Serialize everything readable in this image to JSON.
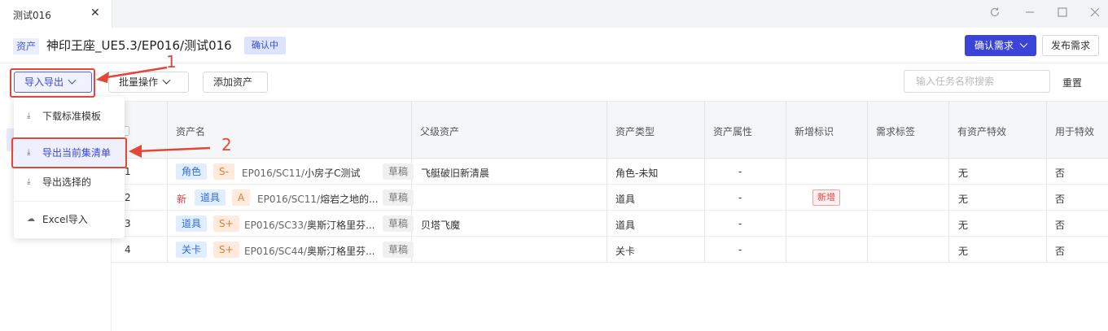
{
  "window": {
    "tab_title": "测试016",
    "tab_close": "✕"
  },
  "header": {
    "asset_tag": "资产",
    "title": "神印王座_UE5.3/EP016/测试016",
    "status": "确认中",
    "confirm_button": "确认需求",
    "publish_button": "发布需求"
  },
  "toolbar": {
    "import_export": "导入导出",
    "batch": "批量操作",
    "add_asset": "添加资产",
    "search_placeholder": "输入任务名称搜索",
    "reset": "重置"
  },
  "dropdown": {
    "items": [
      {
        "label": "下载标准模板",
        "icon": "download-icon"
      },
      {
        "label": "导出当前集清单",
        "icon": "download-icon"
      },
      {
        "label": "导出选择的",
        "icon": "download-icon"
      },
      {
        "label": "Excel导入",
        "icon": "cloud-upload-icon"
      }
    ]
  },
  "table": {
    "columns": [
      "资产名",
      "父级资产",
      "资产类型",
      "资产属性",
      "新增标识",
      "需求标签",
      "有资产特效",
      "用于特效"
    ],
    "rows": [
      {
        "index": "1",
        "new_mark": "",
        "type": "角色",
        "level": "S-",
        "path_prefix": "EP016/SC11/",
        "path_name": "小房子C测试",
        "draft": "草稿",
        "parent": "飞艇破旧新清晨",
        "asset_type": "角色-未知",
        "attr": "-",
        "new_flag": "",
        "tag": "",
        "has_fx": "无",
        "for_fx": "否"
      },
      {
        "index": "2",
        "new_mark": "新",
        "type": "道具",
        "level": "A",
        "path_prefix": "EP016/SC11/",
        "path_name": "熔岩之地的...",
        "draft": "草稿",
        "parent": "",
        "asset_type": "道具",
        "attr": "-",
        "new_flag": "新增",
        "tag": "",
        "has_fx": "无",
        "for_fx": "否"
      },
      {
        "index": "3",
        "new_mark": "",
        "type": "道具",
        "level": "S+",
        "path_prefix": "EP016/SC33/",
        "path_name": "奥斯汀格里芬...",
        "draft": "草稿",
        "parent": "贝塔飞魔",
        "asset_type": "道具",
        "attr": "-",
        "new_flag": "",
        "tag": "",
        "has_fx": "无",
        "for_fx": "否"
      },
      {
        "index": "4",
        "new_mark": "",
        "type": "关卡",
        "level": "S+",
        "path_prefix": "EP016/SC44/",
        "path_name": "奥斯汀格里芬...",
        "draft": "草稿",
        "parent": "",
        "asset_type": "关卡",
        "attr": "-",
        "new_flag": "",
        "tag": "",
        "has_fx": "无",
        "for_fx": "否"
      }
    ]
  },
  "annotations": {
    "step1": "1",
    "step2": "2",
    "color": "#e2473a"
  }
}
